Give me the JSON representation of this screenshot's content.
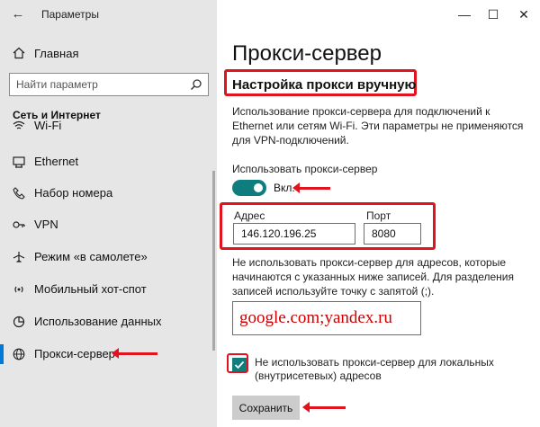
{
  "window": {
    "app_title": "Параметры",
    "back_glyph": "←",
    "minimize_glyph": "—",
    "maximize_glyph": "☐",
    "close_glyph": "✕"
  },
  "sidebar": {
    "home_label": "Главная",
    "search_placeholder": "Найти параметр",
    "section_title": "Сеть и Интернет",
    "items": [
      {
        "label": "Wi-Fi",
        "icon": "wifi-icon"
      },
      {
        "label": "Ethernet",
        "icon": "ethernet-icon"
      },
      {
        "label": "Набор номера",
        "icon": "dialup-icon"
      },
      {
        "label": "VPN",
        "icon": "vpn-icon"
      },
      {
        "label": "Режим «в самолете»",
        "icon": "airplane-icon"
      },
      {
        "label": "Мобильный хот-спот",
        "icon": "hotspot-icon"
      },
      {
        "label": "Использование данных",
        "icon": "data-usage-icon"
      },
      {
        "label": "Прокси-сервер",
        "icon": "globe-icon",
        "active": true
      }
    ]
  },
  "main": {
    "page_title": "Прокси-сервер",
    "section_heading": "Настройка прокси вручную",
    "description": "Использование прокси-сервера для подключений к Ethernet или сетям Wi-Fi. Эти параметры не применяются для VPN-подключений.",
    "use_proxy_label": "Использовать прокси-сервер",
    "toggle_state": "Вкл.",
    "address_label": "Адрес",
    "address_value": "146.120.196.25",
    "port_label": "Порт",
    "port_value": "8080",
    "exceptions_description": "Не использовать прокси-сервер для адресов, которые начинаются с указанных ниже записей. Для разделения записей используйте точку с запятой (;).",
    "exceptions_value": "google.com;yandex.ru",
    "local_bypass_label": "Не использовать прокси-сервер для локальных (внутрисетевых) адресов",
    "local_bypass_checked": true,
    "save_label": "Сохранить"
  },
  "colors": {
    "accent": "#0f7d7d",
    "highlight": "#e0141e",
    "active_indicator": "#0078d7"
  }
}
